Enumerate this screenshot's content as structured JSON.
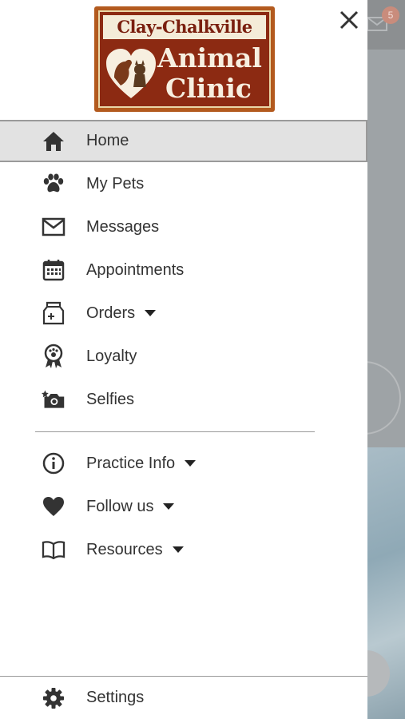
{
  "background": {
    "badge_count": "5"
  },
  "logo": {
    "line1": "Clay-Chalkville",
    "line2": "Animal",
    "line3": "Clinic"
  },
  "menu": {
    "primary": [
      {
        "label": "Home",
        "icon": "home-icon",
        "active": true
      },
      {
        "label": "My Pets",
        "icon": "paw-icon"
      },
      {
        "label": "Messages",
        "icon": "envelope-icon"
      },
      {
        "label": "Appointments",
        "icon": "calendar-icon"
      },
      {
        "label": "Orders",
        "icon": "food-bag-icon",
        "dropdown": true
      },
      {
        "label": "Loyalty",
        "icon": "ribbon-badge-icon"
      },
      {
        "label": "Selfies",
        "icon": "camera-icon"
      }
    ],
    "secondary": [
      {
        "label": "Practice Info",
        "icon": "info-icon",
        "dropdown": true
      },
      {
        "label": "Follow us",
        "icon": "heart-icon",
        "dropdown": true
      },
      {
        "label": "Resources",
        "icon": "book-icon",
        "dropdown": true
      }
    ],
    "settings": {
      "label": "Settings",
      "icon": "gear-icon"
    }
  },
  "colors": {
    "active_row": "#e2e2e2",
    "text": "#333333",
    "logo_red": "#8c2a12",
    "logo_orange": "#b35a1e"
  }
}
